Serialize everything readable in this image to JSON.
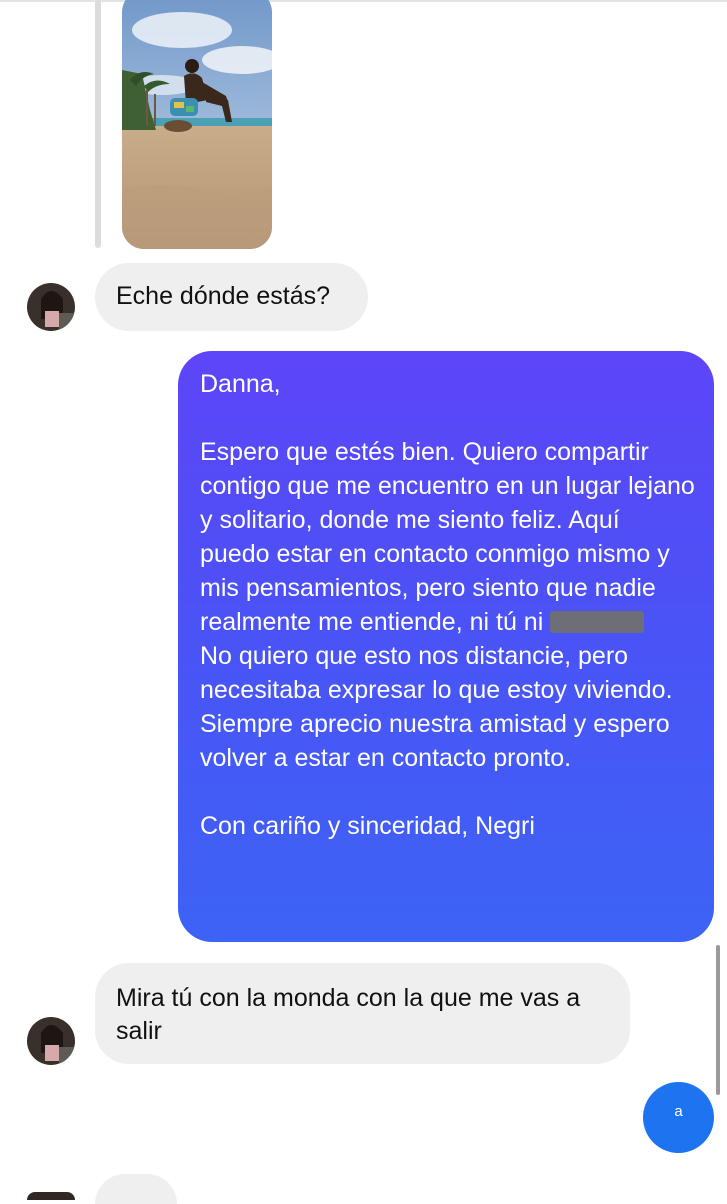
{
  "chat": {
    "shared_photo": {
      "description_icon": "photo-icon"
    },
    "messages": [
      {
        "sender": "other",
        "text": "Eche dónde estás?"
      },
      {
        "sender": "me",
        "greeting": "Danna,",
        "body_before_redaction": "Espero que estés bien. Quiero compartir contigo que me encuentro en un lugar lejano y solitario, donde me siento feliz. Aquí puedo estar en contacto conmigo mismo y mis pensamientos, pero siento que nadie realmente me entiende, ni tú ni",
        "body_after_redaction": "No quiero que esto nos distancie, pero necesitaba expresar lo que estoy viviendo. Siempre aprecio nuestra amistad y espero volver a estar en contacto pronto.",
        "signature": "Con cariño y sinceridad, Negri"
      },
      {
        "sender": "other",
        "text": "Mira tú con la monda con la que me vas a salir"
      },
      {
        "sender": "me",
        "text": "a"
      }
    ]
  },
  "colors": {
    "incoming_bubble": "#efefef",
    "outgoing_gradient_top": "#5d45f8",
    "outgoing_gradient_bottom": "#3d63f5",
    "small_outgoing": "#1d73f0"
  }
}
